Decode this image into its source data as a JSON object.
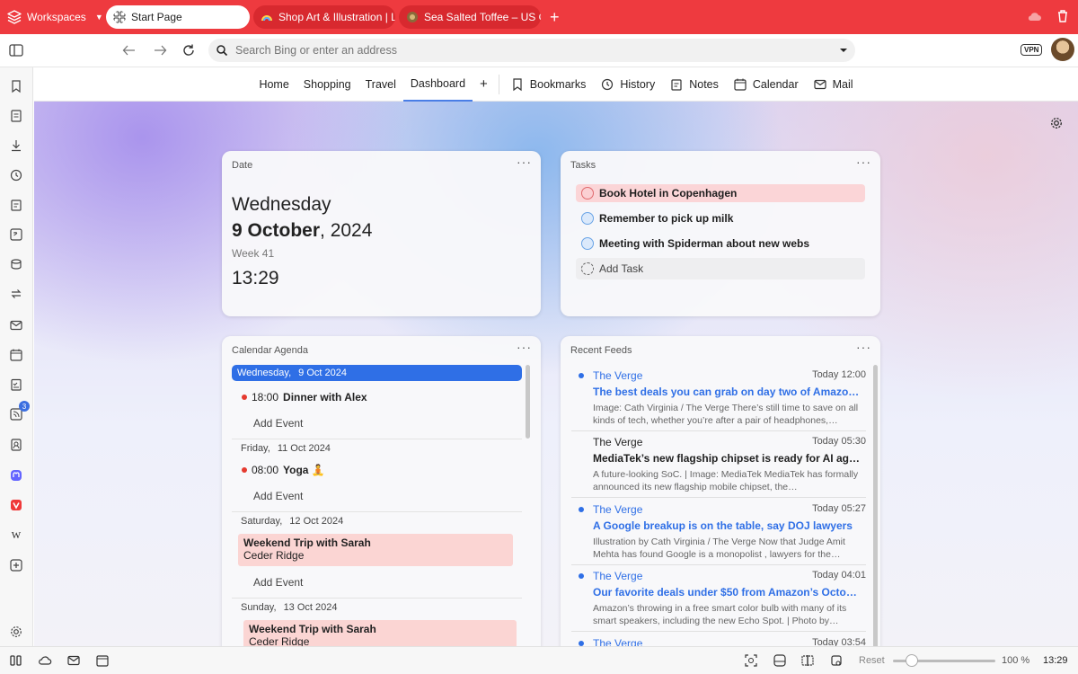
{
  "tabbar": {
    "workspaces": "Workspaces",
    "tabs": [
      {
        "label": "Start Page"
      },
      {
        "label": "Shop Art & Illustration | Lis"
      },
      {
        "label": "Sea Salted Toffee – US On"
      }
    ]
  },
  "address": {
    "placeholder": "Search Bing or enter an address",
    "vpn": "VPN"
  },
  "speed_dial_nav": {
    "items": [
      "Home",
      "Shopping",
      "Travel",
      "Dashboard"
    ],
    "add": "+",
    "panels": [
      "Bookmarks",
      "History",
      "Notes",
      "Calendar",
      "Mail"
    ]
  },
  "date_widget": {
    "title": "Date",
    "weekday": "Wednesday",
    "date_bold": "9 October",
    "date_rest": ", 2024",
    "week": "Week 41",
    "time": "13:29"
  },
  "tasks_widget": {
    "title": "Tasks",
    "items": [
      "Book Hotel in Copenhagen",
      "Remember to pick up milk",
      "Meeting with Spiderman about new webs"
    ],
    "add_label": "Add Task"
  },
  "agenda_widget": {
    "title": "Calendar Agenda",
    "days": [
      {
        "weekday": "Wednesday,",
        "date": "9 Oct 2024",
        "event_time": "18:00",
        "event_title": "Dinner with Alex"
      },
      {
        "weekday": "Friday,",
        "date": "11 Oct 2024",
        "event_time": "08:00",
        "event_title": "Yoga 🧘"
      },
      {
        "weekday": "Saturday,",
        "date": "12 Oct 2024",
        "event_title": "Weekend Trip with Sarah",
        "event_location": "Ceder Ridge"
      },
      {
        "weekday": "Sunday,",
        "date": "13 Oct 2024",
        "event_title": "Weekend Trip with Sarah",
        "event_location": "Ceder Ridge"
      }
    ],
    "add_event": "Add Event"
  },
  "feeds_widget": {
    "title": "Recent Feeds",
    "items": [
      {
        "source": "The Verge",
        "time": "Today 12:00",
        "headline": "The best deals you can grab on day two of Amazon…",
        "summary": "Image: Cath Virginia / The Verge There’s still time to save on all kinds of tech, whether you’re after a pair of headphones,…"
      },
      {
        "source": "The Verge",
        "time": "Today 05:30",
        "headline": "MediaTek’s new flagship chipset is ready for AI age…",
        "summary": "A future-looking SoC. | Image: MediaTek MediaTek has formally announced its new flagship mobile chipset, the…"
      },
      {
        "source": "The Verge",
        "time": "Today 05:27",
        "headline": "A Google breakup is on the table, say DOJ lawyers",
        "summary": "Illustration by Cath Virginia / The Verge Now that Judge Amit Mehta has found Google is a monopolist , lawyers for the…"
      },
      {
        "source": "The Verge",
        "time": "Today 04:01",
        "headline": "Our favorite deals under $50 from Amazon’s Octob…",
        "summary": "Amazon’s throwing in a free smart color bulb with many of its smart speakers, including the new Echo Spot. | Photo by…"
      },
      {
        "source": "The Verge",
        "time": "Today 03:54"
      }
    ]
  },
  "sidebar": {
    "feeds_badge": "3"
  },
  "statusbar": {
    "reset": "Reset",
    "zoom": "100 %",
    "clock": "13:29"
  },
  "colors": {
    "accent": "#ee3a3f",
    "link": "#2f6fe6",
    "task_highlight": "#fbd5d7"
  }
}
